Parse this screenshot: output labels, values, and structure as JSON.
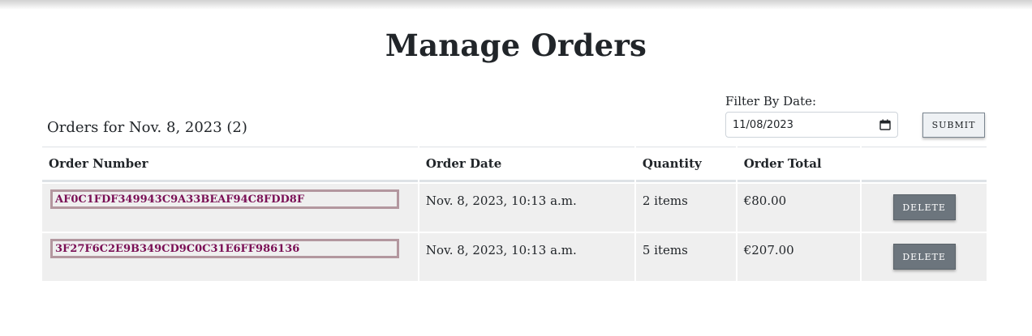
{
  "page": {
    "title": "Manage Orders"
  },
  "orders_heading": "Orders for Nov. 8, 2023 (2)",
  "filter": {
    "label": "Filter By Date:",
    "date_value": "11/08/2023",
    "submit_label": "SUBMIT"
  },
  "table": {
    "headers": [
      "Order Number",
      "Order Date",
      "Quantity",
      "Order Total",
      ""
    ],
    "rows": [
      {
        "order_number": "AF0C1FDF349943C9A33BEAF94C8FDD8F",
        "order_date": "Nov. 8, 2023, 10:13 a.m.",
        "quantity": "2 items",
        "total": "€80.00",
        "delete_label": "DELETE"
      },
      {
        "order_number": "3F27F6C2E9B349CD9C0C31E6FF986136",
        "order_date": "Nov. 8, 2023, 10:13 a.m.",
        "quantity": "5 items",
        "total": "€207.00",
        "delete_label": "DELETE"
      }
    ]
  },
  "icons": {
    "date_picker": "calendar-icon"
  },
  "colors": {
    "link": "#7a0f55",
    "link_border": "#b3979f",
    "delete_button": "#6c757d",
    "row_background": "#efefef"
  }
}
